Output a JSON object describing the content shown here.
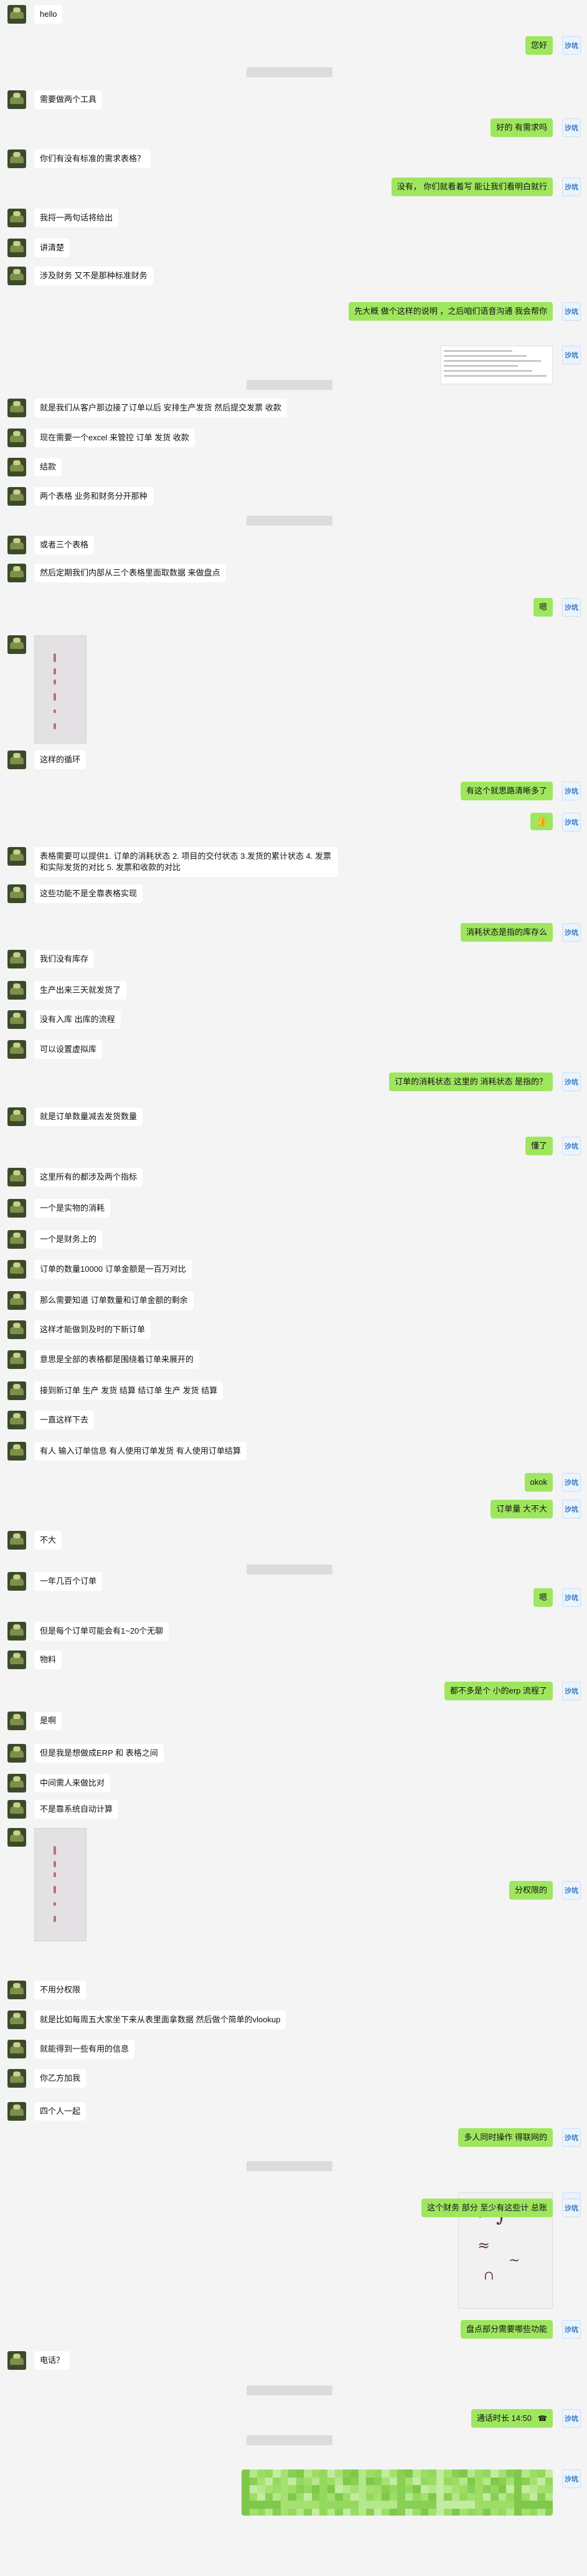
{
  "self_avatar_label": "沙坑",
  "messages": [
    {
      "kind": "text",
      "side": "left",
      "text": "hello"
    },
    {
      "kind": "text",
      "side": "right",
      "text": "您好"
    },
    {
      "kind": "time"
    },
    {
      "kind": "text",
      "side": "left",
      "text": "需要做两个工具"
    },
    {
      "kind": "text",
      "side": "right",
      "text": "好的 有需求吗"
    },
    {
      "kind": "text",
      "side": "left",
      "text": "你们有没有标准的需求表格？"
    },
    {
      "kind": "text",
      "side": "right",
      "text": "没有， 你们就看着写 能让我们看明白就行"
    },
    {
      "kind": "text",
      "side": "left",
      "text": "我捋一两句话将给出"
    },
    {
      "kind": "text",
      "side": "left",
      "text": "讲清楚"
    },
    {
      "kind": "text",
      "side": "left",
      "text": "涉及财务 又不是那种标准财务"
    },
    {
      "kind": "text",
      "side": "right",
      "text": "先大概 做个这样的说明 ，之后咱们语音沟通 我会帮你"
    },
    {
      "kind": "image",
      "side": "right"
    },
    {
      "kind": "time"
    },
    {
      "kind": "text",
      "side": "left",
      "text": "就是我们从客户那边接了订单以后 安排生产发货 然后提交发票 收款"
    },
    {
      "kind": "text",
      "side": "left",
      "text": "现在需要一个excel 来管控 订单 发货 收款"
    },
    {
      "kind": "text",
      "side": "left",
      "text": "结款"
    },
    {
      "kind": "text",
      "side": "left",
      "text": "两个表格 业务和财务分开那种"
    },
    {
      "kind": "time"
    },
    {
      "kind": "text",
      "side": "left",
      "text": "或者三个表格"
    },
    {
      "kind": "text",
      "side": "left",
      "text": "然后定期我们内部从三个表格里面取数据 来做盘点"
    },
    {
      "kind": "text",
      "side": "right",
      "text": "嗯"
    },
    {
      "kind": "image",
      "side": "left"
    },
    {
      "kind": "text",
      "side": "left",
      "text": "这样的循环"
    },
    {
      "kind": "text",
      "side": "right",
      "text": "有这个就思路清晰多了"
    },
    {
      "kind": "emoji",
      "side": "right"
    },
    {
      "kind": "text",
      "side": "left",
      "text": "表格需要可以提供1. 订单的消耗状态 2. 项目的交付状态 3.发货的累计状态 4. 发票和实际发货的对比 5. 发票和收款的对比"
    },
    {
      "kind": "text",
      "side": "left",
      "text": "这些功能不是全靠表格实现"
    },
    {
      "kind": "text",
      "side": "right",
      "text": "消耗状态是指的库存么"
    },
    {
      "kind": "text",
      "side": "left",
      "text": "我们没有库存"
    },
    {
      "kind": "text",
      "side": "left",
      "text": "生产出来三天就发货了"
    },
    {
      "kind": "text",
      "side": "left",
      "text": "没有入库 出库的流程"
    },
    {
      "kind": "text",
      "side": "left",
      "text": "可以设置虚拟库"
    },
    {
      "kind": "text",
      "side": "right",
      "text": "订单的消耗状态 这里的 消耗状态 是指的？"
    },
    {
      "kind": "text",
      "side": "left",
      "text": "就是订单数量减去发货数量"
    },
    {
      "kind": "text",
      "side": "right",
      "text": "懂了"
    },
    {
      "kind": "text",
      "side": "left",
      "text": "这里所有的都涉及两个指标"
    },
    {
      "kind": "text",
      "side": "left",
      "text": "一个是实物的消耗"
    },
    {
      "kind": "text",
      "side": "left",
      "text": "一个是财务上的"
    },
    {
      "kind": "text",
      "side": "left",
      "text": "订单的数量10000 订单金额是一百万对比"
    },
    {
      "kind": "text",
      "side": "left",
      "text": "那么需要知道 订单数量和订单金额的剩余"
    },
    {
      "kind": "text",
      "side": "left",
      "text": "这样才能做到及时的下新订单"
    },
    {
      "kind": "text",
      "side": "left",
      "text": "意思是全部的表格都是围绕着订单来展开的"
    },
    {
      "kind": "text",
      "side": "left",
      "text": "接到新订单 生产 发货 结算 结订单 生产 发货 结算"
    },
    {
      "kind": "text",
      "side": "left",
      "text": "一直这样下去"
    },
    {
      "kind": "text",
      "side": "left",
      "text": "有人 输入订单信息 有人使用订单发货 有人使用订单结算"
    },
    {
      "kind": "text",
      "side": "right",
      "text": "okok"
    },
    {
      "kind": "text",
      "side": "right",
      "text": "订单量 大不大"
    },
    {
      "kind": "text",
      "side": "left",
      "text": "不大"
    },
    {
      "kind": "time"
    },
    {
      "kind": "text",
      "side": "left",
      "text": "一年几百个订单"
    },
    {
      "kind": "text",
      "side": "right",
      "text": "嗯"
    },
    {
      "kind": "text",
      "side": "left",
      "text": "但是每个订单可能会有1~20个无聊"
    },
    {
      "kind": "text",
      "side": "left",
      "text": "物料"
    },
    {
      "kind": "text",
      "side": "right",
      "text": "都不多是个 小的erp 流程了"
    },
    {
      "kind": "text",
      "side": "left",
      "text": "是啊"
    },
    {
      "kind": "text",
      "side": "left",
      "text": "但是我是想做成ERP 和 表格之间"
    },
    {
      "kind": "text",
      "side": "left",
      "text": "中间需人来做比对"
    },
    {
      "kind": "text",
      "side": "left",
      "text": "不是靠系统自动计算"
    },
    {
      "kind": "image",
      "side": "left"
    },
    {
      "kind": "text",
      "side": "right",
      "text": "分权限的"
    },
    {
      "kind": "text",
      "side": "left",
      "text": "不用分权限"
    },
    {
      "kind": "text",
      "side": "left",
      "text": "就是比如每周五大家坐下来从表里面拿数据 然后做个简单的vlookup"
    },
    {
      "kind": "text",
      "side": "left",
      "text": "就能得到一些有用的信息"
    },
    {
      "kind": "text",
      "side": "left",
      "text": "你乙方加我"
    },
    {
      "kind": "text",
      "side": "left",
      "text": "四个人一起"
    },
    {
      "kind": "text",
      "side": "right",
      "text": "多人同时操作 得联网的"
    },
    {
      "kind": "time"
    },
    {
      "kind": "image",
      "side": "right"
    },
    {
      "kind": "text",
      "side": "right",
      "text": "这个财务 部分 至少有这些计 总账"
    },
    {
      "kind": "text",
      "side": "right",
      "text": "盘点部分需要哪些功能"
    },
    {
      "kind": "text",
      "side": "left",
      "text": "电话？"
    },
    {
      "kind": "time"
    },
    {
      "kind": "call",
      "side": "right",
      "text": "通话时长 14:50"
    },
    {
      "kind": "time"
    },
    {
      "kind": "mosaic",
      "side": "right"
    }
  ]
}
